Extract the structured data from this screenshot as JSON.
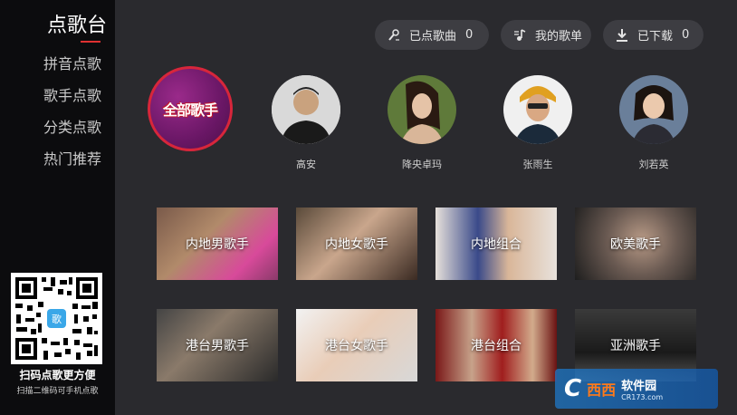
{
  "sidebar": {
    "title": "点歌台",
    "items": [
      "拼音点歌",
      "歌手点歌",
      "分类点歌",
      "热门推荐"
    ],
    "qr_caption": "扫码点歌更方便",
    "qr_subcaption": "扫描二维码可手机点歌"
  },
  "toolbar": {
    "ordered": {
      "label": "已点歌曲",
      "count": "0",
      "icon": "mic-icon"
    },
    "mylist": {
      "label": "我的歌单",
      "icon": "music-note-icon"
    },
    "downloaded": {
      "label": "已下载",
      "count": "0",
      "icon": "download-icon"
    }
  },
  "all_singers_label": "全部歌手",
  "singers": [
    {
      "name": "高安"
    },
    {
      "name": "降央卓玛"
    },
    {
      "name": "张雨生"
    },
    {
      "name": "刘若英"
    }
  ],
  "categories": [
    {
      "label": "内地男歌手"
    },
    {
      "label": "内地女歌手"
    },
    {
      "label": "内地组合"
    },
    {
      "label": "欧美歌手"
    },
    {
      "label": "港台男歌手"
    },
    {
      "label": "港台女歌手"
    },
    {
      "label": "港台组合"
    },
    {
      "label": "亚洲歌手"
    }
  ],
  "watermark": {
    "logo": "C",
    "mid": "西西",
    "name": "软件园",
    "domain": "CR173.com"
  },
  "colors": {
    "accent": "#e03131",
    "sidebar_bg": "#0c0c0e",
    "main_bg": "#2a2a2e"
  }
}
